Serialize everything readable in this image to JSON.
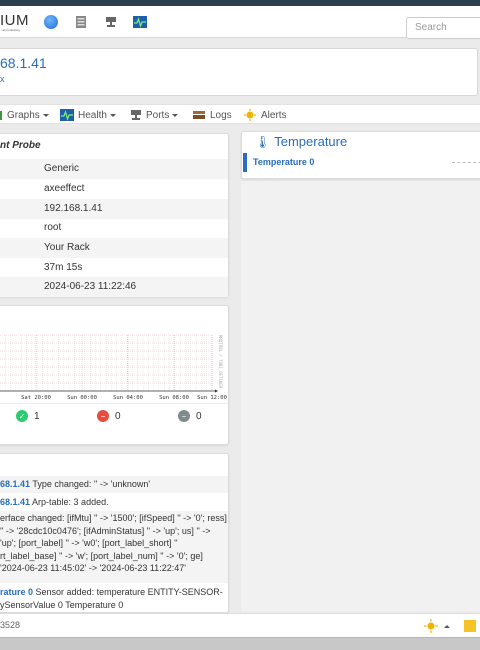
{
  "nav": {
    "logo": "IUM",
    "logo_sub": "...al monitoring",
    "search_placeholder": "Search"
  },
  "device": {
    "title": "68.1.41",
    "subtitle": "x"
  },
  "tabs": [
    {
      "label": "Graphs",
      "icon": "graphs-icon"
    },
    {
      "label": "Health",
      "icon": "health-icon"
    },
    {
      "label": "Ports",
      "icon": "ports-icon"
    },
    {
      "label": "Logs",
      "icon": "logs-icon"
    },
    {
      "label": "Alerts",
      "icon": "alerts-icon"
    }
  ],
  "overview": {
    "title": "nt Probe",
    "rows": [
      {
        "value": "Generic"
      },
      {
        "value": "axeeffect"
      },
      {
        "value": "192.168.1.41"
      },
      {
        "value": "root"
      },
      {
        "value": "Your Rack"
      },
      {
        "value": "37m 15s"
      },
      {
        "value": "2024-06-23 11:22:46"
      }
    ]
  },
  "ping_graph": {
    "rotated_label": "RRDTOOL / TOBI OETIKER",
    "status": [
      {
        "value": "1",
        "color": "#2ecc71",
        "icon": "check-icon"
      },
      {
        "value": "0",
        "color": "#e74c3c",
        "icon": "minus-icon"
      },
      {
        "value": "0",
        "color": "#7f8c8d",
        "icon": "minus-icon"
      }
    ]
  },
  "chart_data": {
    "type": "line",
    "x": [
      "Sat 20:00",
      "Sun 00:00",
      "Sun 04:00",
      "Sun 08:00",
      "Sun 12:00"
    ],
    "series": [],
    "grid": true
  },
  "events": [
    {
      "link": "68.1.41",
      "text": " Type changed: '' -> 'unknown'"
    },
    {
      "link": "68.1.41",
      "text": " Arp-table: 3 added."
    },
    {
      "link": "",
      "text": "erface changed: [ifMtu] '' -> '1500'; [ifSpeed] '' -> '0'; ress] '' -> '28cdc10c0476'; [ifAdminStatus] '' -> 'up'; us] '' -> 'up'; [port_label] '' -> 'w0'; [port_label_short] '' rt_label_base] '' -> 'w'; [port_label_num] '' -> '0'; ge] '2024-06-23 11:45:02' -> '2024-06-23 11:22:47'"
    },
    {
      "link": "rature 0",
      "text": " Sensor added: temperature ENTITY-SENSOR- ySensorValue 0 Temperature 0"
    }
  ],
  "temperature": {
    "title": "Temperature",
    "row_label": "Temperature 0"
  },
  "footer": {
    "number": "3528"
  }
}
